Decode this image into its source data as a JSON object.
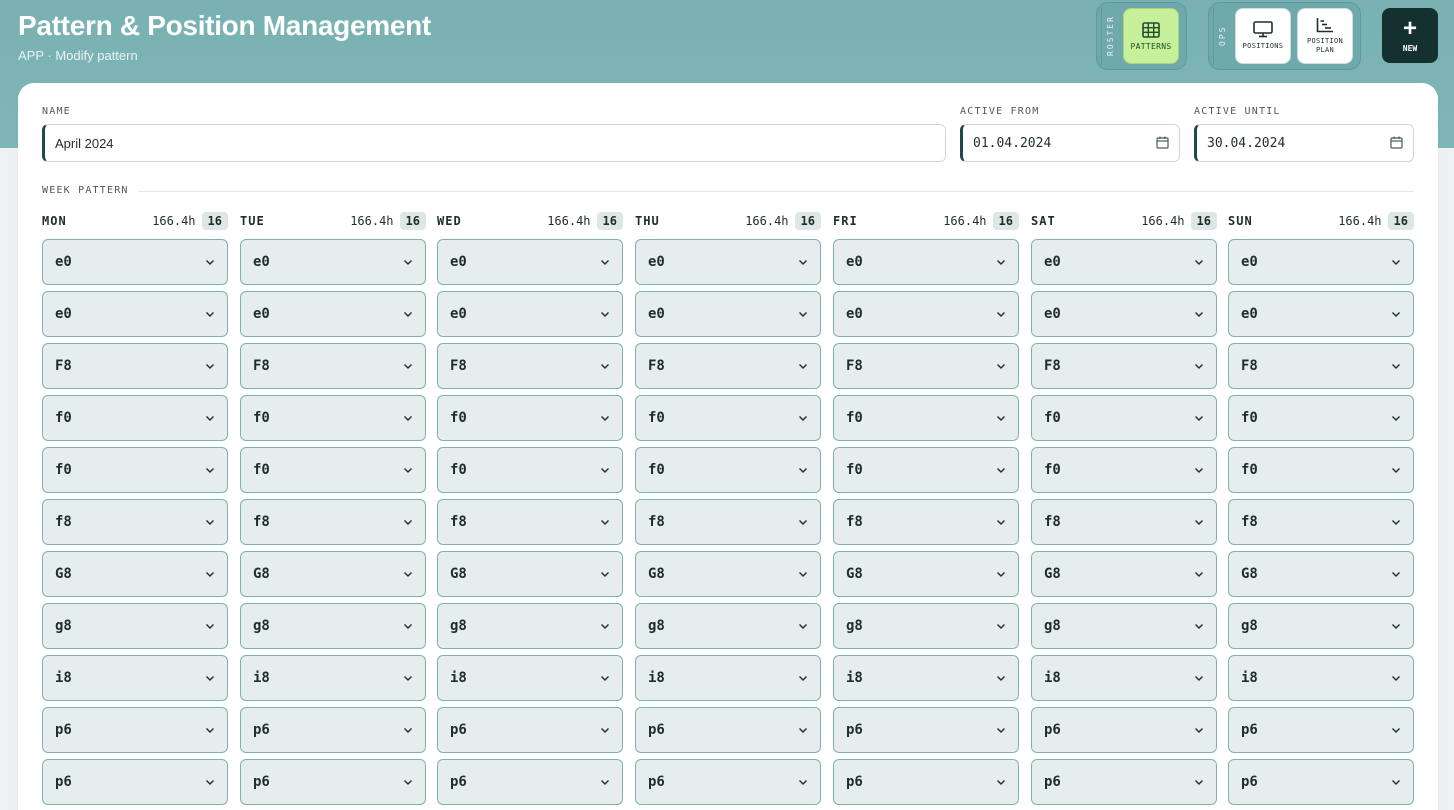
{
  "header": {
    "title": "Pattern & Position Management",
    "subtitle": "APP · Modify pattern"
  },
  "nav": {
    "roster_label": "ROSTER",
    "ops_label": "OPS",
    "patterns_label": "PATTERNS",
    "positions_label": "POSITIONS",
    "position_plan_label": "POSITION PLAN",
    "new_label": "NEW"
  },
  "form": {
    "name_label": "NAME",
    "name_value": "April 2024",
    "active_from_label": "ACTIVE FROM",
    "active_from_value": "01.04.2024",
    "active_until_label": "ACTIVE UNTIL",
    "active_until_value": "30.04.2024"
  },
  "week_pattern": {
    "label": "WEEK PATTERN",
    "days": [
      {
        "name": "MON",
        "hours": "166.4h",
        "count": "16"
      },
      {
        "name": "TUE",
        "hours": "166.4h",
        "count": "16"
      },
      {
        "name": "WED",
        "hours": "166.4h",
        "count": "16"
      },
      {
        "name": "THU",
        "hours": "166.4h",
        "count": "16"
      },
      {
        "name": "FRI",
        "hours": "166.4h",
        "count": "16"
      },
      {
        "name": "SAT",
        "hours": "166.4h",
        "count": "16"
      },
      {
        "name": "SUN",
        "hours": "166.4h",
        "count": "16"
      }
    ],
    "shifts": [
      "e0",
      "e0",
      "F8",
      "f0",
      "f0",
      "f8",
      "G8",
      "g8",
      "i8",
      "p6",
      "p6"
    ]
  },
  "colors": {
    "header_teal": "#7fb6b8",
    "active_green": "#c8ef9a",
    "new_dark": "#14302f",
    "select_bg": "#e5eeed"
  }
}
